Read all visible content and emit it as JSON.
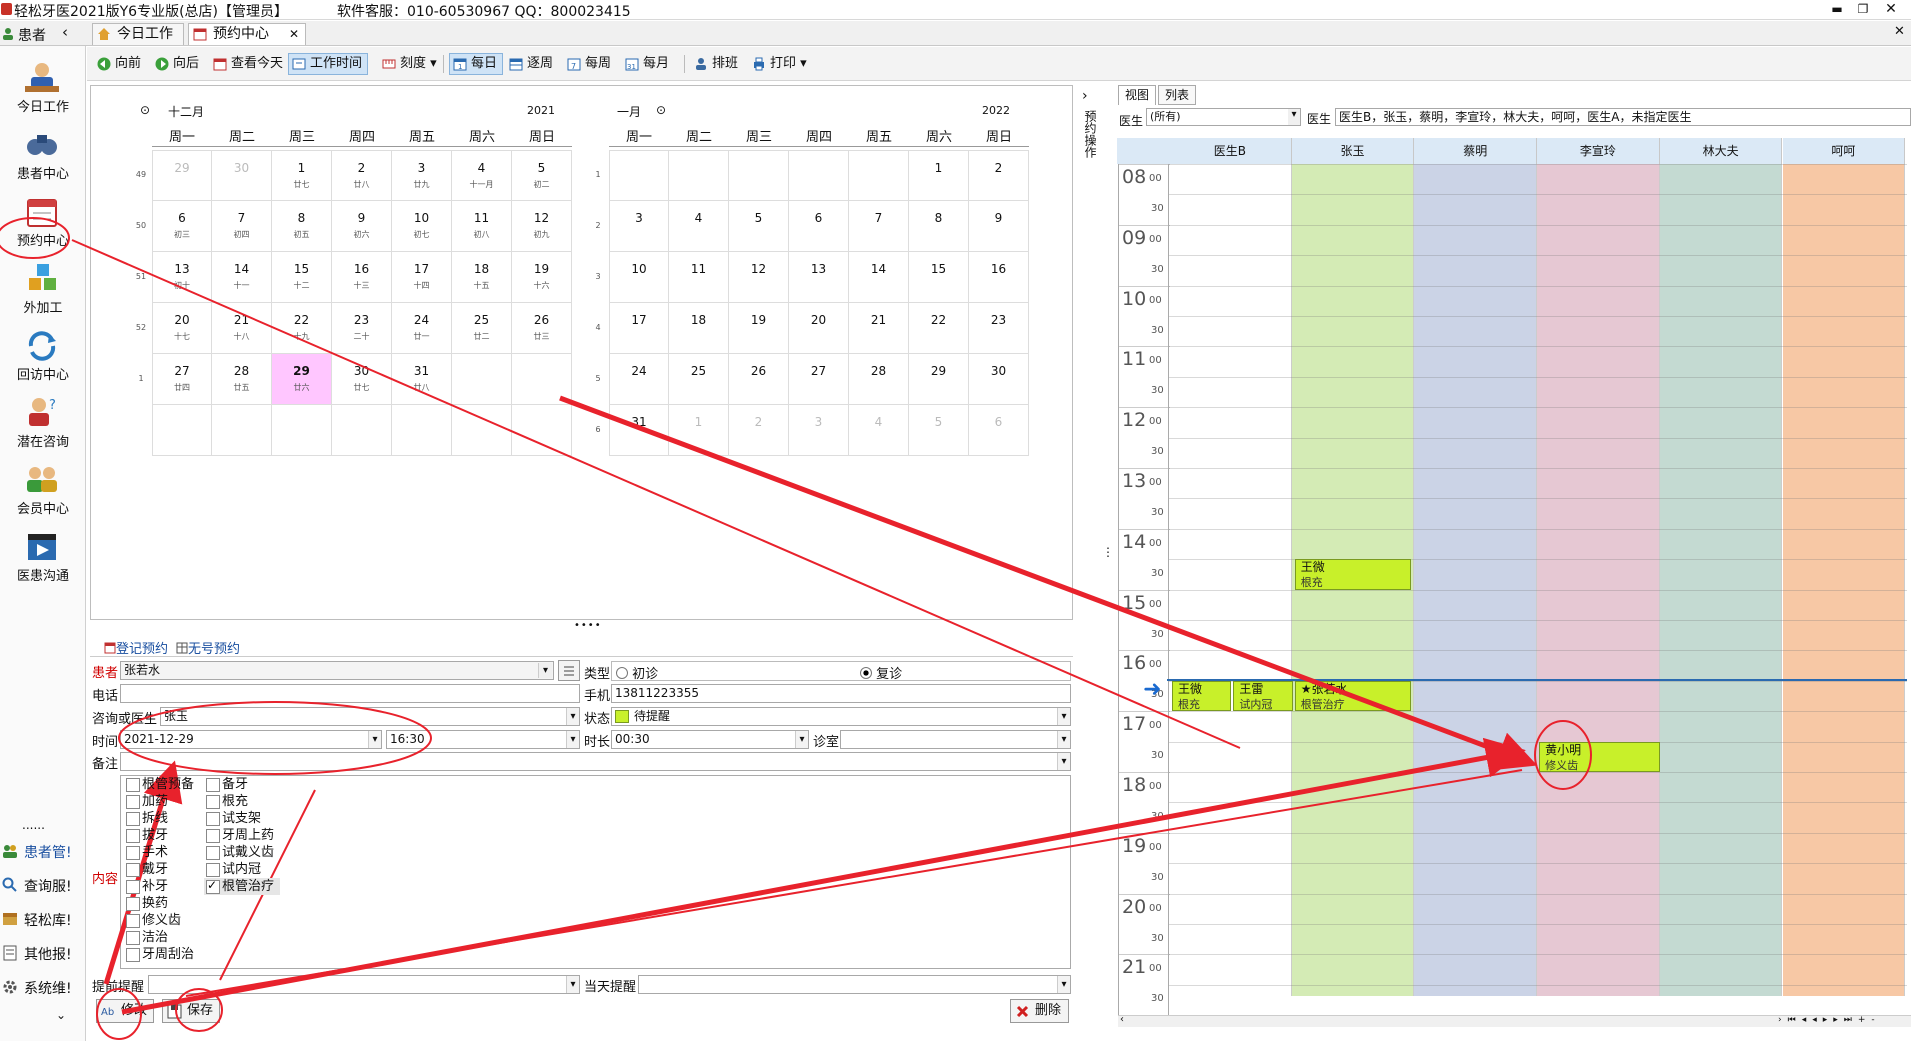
{
  "window": {
    "title": "轻松牙医2021版Y6专业版(总店)【管理员】",
    "service": "软件客服：010-60530967 QQ：800023415"
  },
  "sidebar": {
    "header": "患者",
    "items": [
      {
        "label": "今日工作"
      },
      {
        "label": "患者中心"
      },
      {
        "label": "预约中心"
      },
      {
        "label": "外加工"
      },
      {
        "label": "回访中心"
      },
      {
        "label": "潜在咨询"
      },
      {
        "label": "会员中心"
      },
      {
        "label": "医患沟通"
      }
    ],
    "dots": "......",
    "links": [
      {
        "label": "患者管!"
      },
      {
        "label": "查询服!"
      },
      {
        "label": "轻松库!"
      },
      {
        "label": "其他报!"
      },
      {
        "label": "系统维!"
      }
    ]
  },
  "tabs": [
    {
      "label": "今日工作"
    },
    {
      "label": "预约中心"
    }
  ],
  "toolbar": {
    "items": [
      "向前",
      "向后",
      "查看今天",
      "工作时间",
      "刻度",
      "每日",
      "逐周",
      "每周",
      "每月",
      "排班",
      "打印"
    ]
  },
  "calendar_dec": {
    "month": "十二月",
    "year": "2021",
    "weekdays": [
      "周一",
      "周二",
      "周三",
      "周四",
      "周五",
      "周六",
      "周日"
    ],
    "weeks": [
      "49",
      "50",
      "51",
      "52",
      "1"
    ],
    "rows": [
      [
        {
          "n": "29",
          "l": "",
          "d": 1
        },
        {
          "n": "30",
          "l": "",
          "d": 1
        },
        {
          "n": "1",
          "l": "廿七",
          "d": 0
        },
        {
          "n": "2",
          "l": "廿八",
          "d": 0
        },
        {
          "n": "3",
          "l": "廿九",
          "d": 0
        },
        {
          "n": "4",
          "l": "十一月",
          "d": 0
        },
        {
          "n": "5",
          "l": "初二",
          "d": 0
        }
      ],
      [
        {
          "n": "6",
          "l": "初三",
          "d": 0
        },
        {
          "n": "7",
          "l": "初四",
          "d": 0
        },
        {
          "n": "8",
          "l": "初五",
          "d": 0
        },
        {
          "n": "9",
          "l": "初六",
          "d": 0
        },
        {
          "n": "10",
          "l": "初七",
          "d": 0
        },
        {
          "n": "11",
          "l": "初八",
          "d": 0
        },
        {
          "n": "12",
          "l": "初九",
          "d": 0
        }
      ],
      [
        {
          "n": "13",
          "l": "初十",
          "d": 0
        },
        {
          "n": "14",
          "l": "十一",
          "d": 0
        },
        {
          "n": "15",
          "l": "十二",
          "d": 0
        },
        {
          "n": "16",
          "l": "十三",
          "d": 0
        },
        {
          "n": "17",
          "l": "十四",
          "d": 0
        },
        {
          "n": "18",
          "l": "十五",
          "d": 0
        },
        {
          "n": "19",
          "l": "十六",
          "d": 0
        }
      ],
      [
        {
          "n": "20",
          "l": "十七",
          "d": 0
        },
        {
          "n": "21",
          "l": "十八",
          "d": 0
        },
        {
          "n": "22",
          "l": "十九",
          "d": 0
        },
        {
          "n": "23",
          "l": "二十",
          "d": 0
        },
        {
          "n": "24",
          "l": "廿一",
          "d": 0
        },
        {
          "n": "25",
          "l": "廿二",
          "d": 0
        },
        {
          "n": "26",
          "l": "廿三",
          "d": 0
        }
      ],
      [
        {
          "n": "27",
          "l": "廿四",
          "d": 0
        },
        {
          "n": "28",
          "l": "廿五",
          "d": 0
        },
        {
          "n": "29",
          "l": "廿六",
          "d": 0,
          "t": 1
        },
        {
          "n": "30",
          "l": "廿七",
          "d": 0
        },
        {
          "n": "31",
          "l": "廿八",
          "d": 0
        },
        {
          "n": "",
          "l": "",
          "d": 0
        },
        {
          "n": "",
          "l": "",
          "d": 0
        }
      ],
      [
        {
          "n": "",
          "l": "",
          "d": 0
        },
        {
          "n": "",
          "l": "",
          "d": 0
        },
        {
          "n": "",
          "l": "",
          "d": 0
        },
        {
          "n": "",
          "l": "",
          "d": 0
        },
        {
          "n": "",
          "l": "",
          "d": 0
        },
        {
          "n": "",
          "l": "",
          "d": 0
        },
        {
          "n": "",
          "l": "",
          "d": 0
        }
      ]
    ]
  },
  "calendar_jan": {
    "month": "一月",
    "year": "2022",
    "weekdays": [
      "周一",
      "周二",
      "周三",
      "周四",
      "周五",
      "周六",
      "周日"
    ],
    "weeks": [
      "1",
      "2",
      "3",
      "4",
      "5",
      "6"
    ],
    "rows": [
      [
        {
          "n": "",
          "d": 0
        },
        {
          "n": "",
          "d": 0
        },
        {
          "n": "",
          "d": 0
        },
        {
          "n": "",
          "d": 0
        },
        {
          "n": "",
          "d": 0
        },
        {
          "n": "1",
          "d": 0
        },
        {
          "n": "2",
          "d": 0
        }
      ],
      [
        {
          "n": "3",
          "d": 0
        },
        {
          "n": "4",
          "d": 0
        },
        {
          "n": "5",
          "d": 0
        },
        {
          "n": "6",
          "d": 0
        },
        {
          "n": "7",
          "d": 0
        },
        {
          "n": "8",
          "d": 0
        },
        {
          "n": "9",
          "d": 0
        }
      ],
      [
        {
          "n": "10",
          "d": 0
        },
        {
          "n": "11",
          "d": 0
        },
        {
          "n": "12",
          "d": 0
        },
        {
          "n": "13",
          "d": 0
        },
        {
          "n": "14",
          "d": 0
        },
        {
          "n": "15",
          "d": 0
        },
        {
          "n": "16",
          "d": 0
        }
      ],
      [
        {
          "n": "17",
          "d": 0
        },
        {
          "n": "18",
          "d": 0
        },
        {
          "n": "19",
          "d": 0
        },
        {
          "n": "20",
          "d": 0
        },
        {
          "n": "21",
          "d": 0
        },
        {
          "n": "22",
          "d": 0
        },
        {
          "n": "23",
          "d": 0
        }
      ],
      [
        {
          "n": "24",
          "d": 0
        },
        {
          "n": "25",
          "d": 0
        },
        {
          "n": "26",
          "d": 0
        },
        {
          "n": "27",
          "d": 0
        },
        {
          "n": "28",
          "d": 0
        },
        {
          "n": "29",
          "d": 0
        },
        {
          "n": "30",
          "d": 0
        }
      ],
      [
        {
          "n": "31",
          "d": 0
        },
        {
          "n": "1",
          "d": 1
        },
        {
          "n": "2",
          "d": 1
        },
        {
          "n": "3",
          "d": 1
        },
        {
          "n": "4",
          "d": 1
        },
        {
          "n": "5",
          "d": 1
        },
        {
          "n": "6",
          "d": 1
        }
      ]
    ]
  },
  "side_handle": "预约操作",
  "form": {
    "tab_register": "登记预约",
    "tab_noreg": "无号预约",
    "patient_label": "患者",
    "patient_value": "张若水",
    "type_label": "类型",
    "type_first": "初诊",
    "type_return": "复诊",
    "phone_label": "电话",
    "phone_value": "",
    "mobile_label": "手机",
    "mobile_value": "13811223355",
    "doctor_label": "咨询或医生",
    "doctor_value": "张玉",
    "status_label": "状态",
    "status_value": "待提醒",
    "time_label": "时间",
    "date_value": "2021-12-29",
    "clock_value": "16:30",
    "duration_label": "时长",
    "duration_value": "00:30",
    "room_label": "诊室",
    "room_value": "",
    "note_label": "备注",
    "content_label": "内容",
    "content_col1": [
      "根管预备",
      "加药",
      "拆线",
      "拔牙",
      "手术",
      "戴牙",
      "补牙",
      "换药",
      "修义齿",
      "洁治",
      "牙周刮治"
    ],
    "content_col2": [
      "备牙",
      "根充",
      "试支架",
      "牙周上药",
      "试戴义齿",
      "试内冠",
      "根管治疗"
    ],
    "checked": "根管治疗",
    "remind_before_label": "提前提醒",
    "remind_today_label": "当天提醒",
    "modify_btn": "修改",
    "save_btn": "保存",
    "delete_btn": "删除"
  },
  "schedule": {
    "tab_view": "视图",
    "tab_list": "列表",
    "doctor_label": "医生",
    "doctor_filter": "(所有)",
    "doctor_label2": "医生",
    "doctor_list": "医生B，张玉，蔡明，李宣玲，林大夫，呵呵，医生A，未指定医生",
    "columns": [
      "医生B",
      "张玉",
      "蔡明",
      "李宣玲",
      "林大夫",
      "呵呵"
    ],
    "column_colors": [
      "#ffffff",
      "#d4ebb5",
      "#cbd3e6",
      "#e6c8d3",
      "#c4dad2",
      "#f7c8a5"
    ],
    "hours": [
      "08",
      "09",
      "10",
      "11",
      "12",
      "13",
      "14",
      "15",
      "16",
      "17",
      "18",
      "19",
      "20",
      "21"
    ],
    "minute_00": "00",
    "minute_30": "30",
    "appointments": [
      {
        "name": "王微",
        "sub": "根充",
        "col": 1,
        "start": "14:30",
        "end": "15:00"
      },
      {
        "name": "王微",
        "sub": "根充",
        "col": 0,
        "start": "16:30",
        "end": "17:00"
      },
      {
        "name": "王雷",
        "sub": "试内冠",
        "col": 0,
        "start": "16:30",
        "end": "17:00"
      },
      {
        "name": "★张若水",
        "sub": "根管治疗",
        "col": 1,
        "start": "16:30",
        "end": "17:00"
      },
      {
        "name": "黄小明",
        "sub": "修义齿",
        "col": 3,
        "start": "17:30",
        "end": "18:00"
      }
    ]
  },
  "annotations": {
    "color": "#e8222c"
  }
}
